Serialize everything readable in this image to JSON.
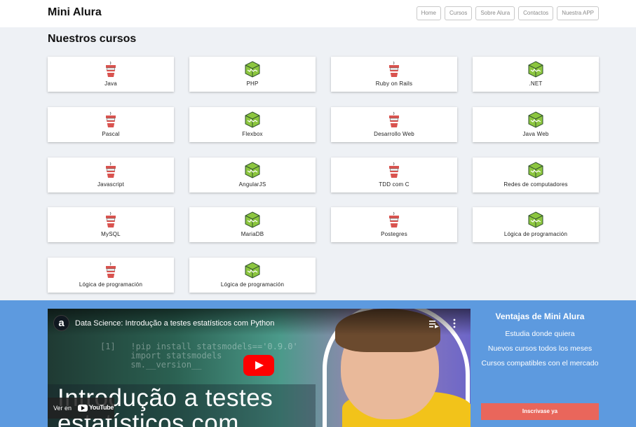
{
  "header": {
    "logo": "Mini Alura",
    "nav": [
      "Home",
      "Cursos",
      "Sobre Alura",
      "Contactos",
      "Nuestra APP"
    ]
  },
  "courses": {
    "title": "Nuestros cursos",
    "items": [
      {
        "label": "Java",
        "icon": "red-mug-icon"
      },
      {
        "label": "PHP",
        "icon": "green-box-icon"
      },
      {
        "label": "Ruby on Rails",
        "icon": "red-mug-icon"
      },
      {
        "label": ".NET",
        "icon": "green-box-icon"
      },
      {
        "label": "Pascal",
        "icon": "red-mug-icon"
      },
      {
        "label": "Flexbox",
        "icon": "green-box-icon"
      },
      {
        "label": "Desarrollo Web",
        "icon": "red-mug-icon"
      },
      {
        "label": "Java Web",
        "icon": "green-box-icon"
      },
      {
        "label": "Javascript",
        "icon": "red-mug-icon"
      },
      {
        "label": "AngularJS",
        "icon": "green-box-icon"
      },
      {
        "label": "TDD com C",
        "icon": "red-mug-icon"
      },
      {
        "label": "Redes de computadores",
        "icon": "green-box-icon"
      },
      {
        "label": "MySQL",
        "icon": "red-mug-icon"
      },
      {
        "label": "MariaDB",
        "icon": "green-box-icon"
      },
      {
        "label": "Postegres",
        "icon": "red-mug-icon"
      },
      {
        "label": "Lógica de programación",
        "icon": "green-box-icon"
      },
      {
        "label": "Lógica de programación",
        "icon": "red-mug-icon"
      },
      {
        "label": "Lógica de programación",
        "icon": "green-box-icon"
      }
    ]
  },
  "video": {
    "title": "Data Science: Introdução a testes estatísticos com Python",
    "channel_letter": "a",
    "overlay_text": "Introdução a testes\nestatísticos com",
    "code_lines": "[1]   !pip install statsmodels=='0.9.0'\n      import statsmodels\n      sm.__version__",
    "watch_on": "Ver en",
    "youtube": "YouTube"
  },
  "benefits": {
    "title": "Ventajas de Mini Alura",
    "items": [
      "Estudia donde quiera",
      "Nuevos cursos todos los meses",
      "Cursos compatibles con el mercado"
    ],
    "cta": "Inscrivase ya"
  },
  "colors": {
    "banner": "#5d9adf",
    "cta": "#e9665b",
    "mug_red": "#d9534f",
    "box_green": "#8cc63f"
  }
}
